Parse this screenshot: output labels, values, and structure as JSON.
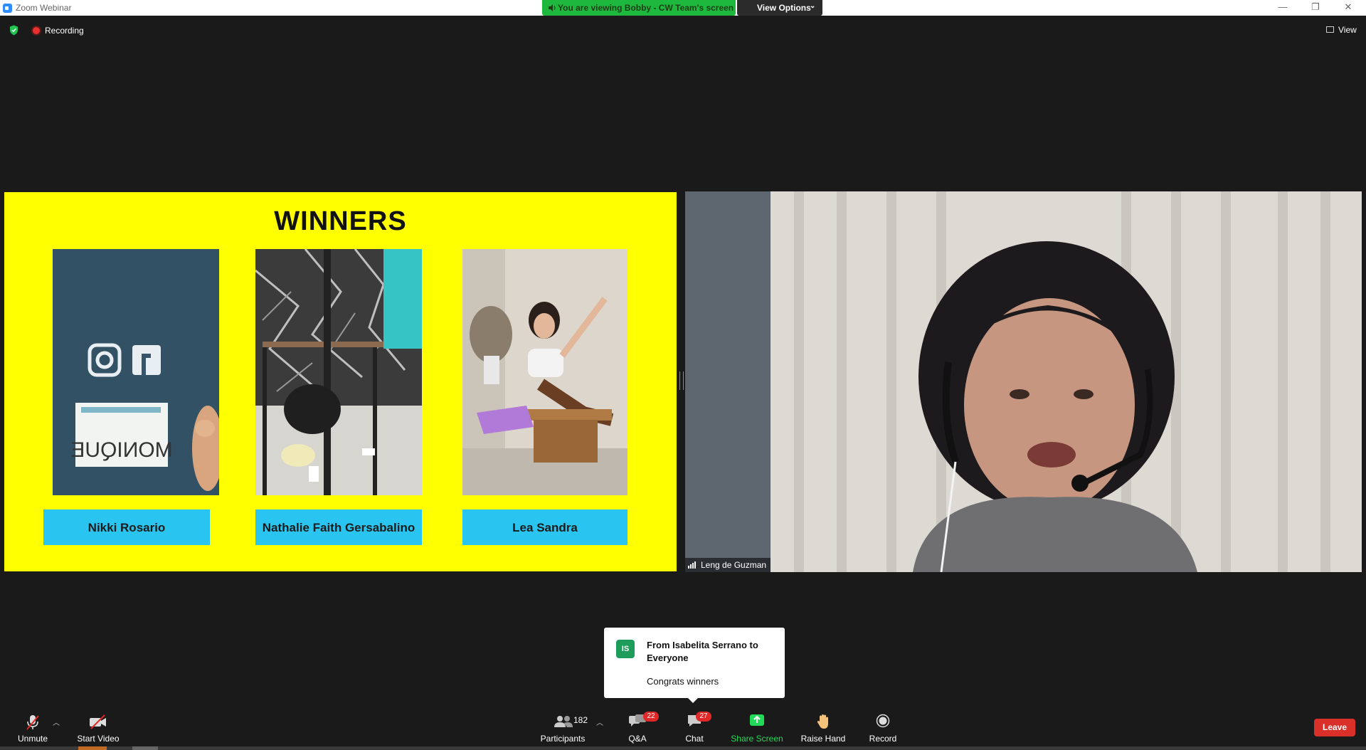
{
  "window": {
    "title": "Zoom Webinar",
    "minimize": "—",
    "restore": "❐",
    "close": "✕"
  },
  "banner": {
    "viewing_text": "You are viewing Bobby - CW Team's screen",
    "view_options_label": "View Options",
    "accent": "#1fb83f"
  },
  "status": {
    "recording_label": "Recording",
    "view_label": "View"
  },
  "slide": {
    "title": "WINNERS",
    "background": "#ffff00",
    "name_color": "#29c5f0",
    "winners": [
      {
        "name": "Nikki Rosario"
      },
      {
        "name": "Nathalie Faith Gersabalino"
      },
      {
        "name": "Lea Sandra"
      }
    ]
  },
  "video": {
    "participant_name": "Leng de Guzman"
  },
  "chat_popup": {
    "avatar_initials": "IS",
    "from": "From Isabelita Serrano to Everyone",
    "message": "Congrats winners"
  },
  "toolbar": {
    "unmute": "Unmute",
    "start_video": "Start Video",
    "participants": "Participants",
    "participants_count": "182",
    "qa": "Q&A",
    "qa_badge": "22",
    "chat": "Chat",
    "chat_badge": "27",
    "share_screen": "Share Screen",
    "raise_hand": "Raise Hand",
    "record": "Record",
    "leave": "Leave",
    "share_color": "#23d959",
    "leave_color": "#d9302a"
  }
}
